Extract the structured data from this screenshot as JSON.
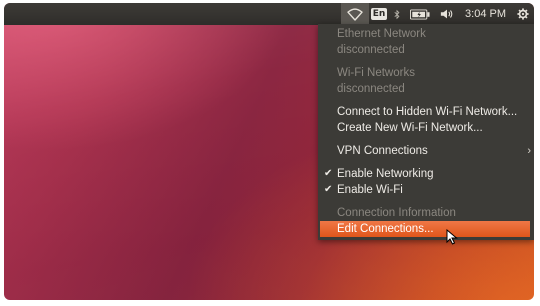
{
  "topbar": {
    "keyboard_layout": "En",
    "clock": "3:04 PM",
    "icons": [
      "wifi-icon",
      "keyboard-layout-indicator",
      "bluetooth-icon",
      "battery-icon",
      "volume-icon",
      "gear-icon"
    ]
  },
  "menu": {
    "ethernet_header": "Ethernet Network",
    "ethernet_status": "disconnected",
    "wifi_header": "Wi-Fi Networks",
    "wifi_status": "disconnected",
    "connect_hidden": "Connect to Hidden Wi-Fi Network...",
    "create_new": "Create New Wi-Fi Network...",
    "vpn": "VPN Connections",
    "enable_networking": "Enable Networking",
    "enable_wifi": "Enable Wi-Fi",
    "connection_info": "Connection Information",
    "edit_connections": "Edit Connections..."
  },
  "colors": {
    "menu_background": "#3c3b37",
    "highlight": "#e95420",
    "panel": "#2f2d2a"
  }
}
